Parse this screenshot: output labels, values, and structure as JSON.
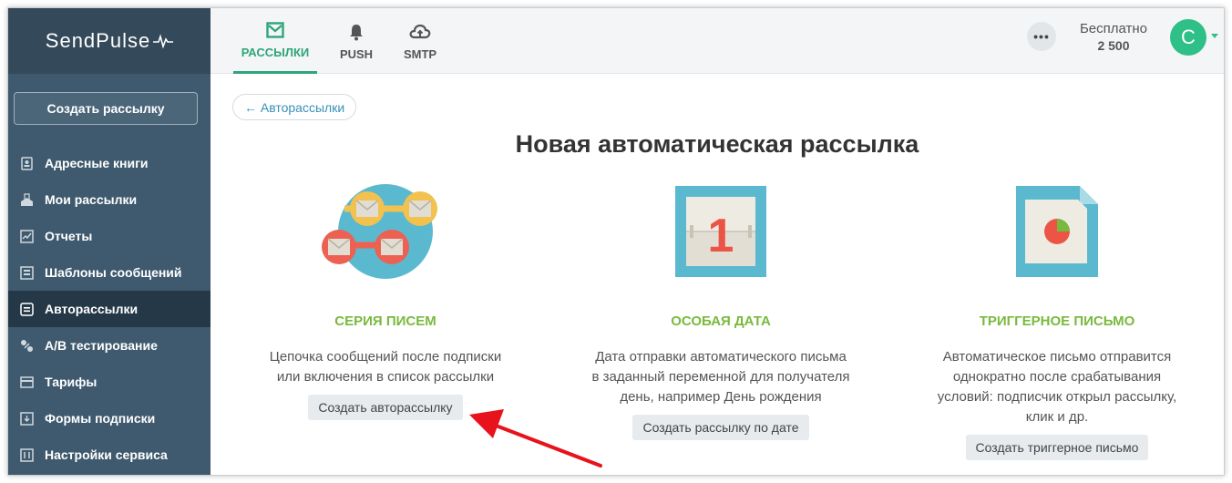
{
  "app": {
    "logo_text": "SendPulse"
  },
  "sidebar": {
    "create_label": "Создать рассылку",
    "items": [
      {
        "label": "Адресные книги",
        "icon": "address-book-icon"
      },
      {
        "label": "Мои рассылки",
        "icon": "campaigns-icon"
      },
      {
        "label": "Отчеты",
        "icon": "reports-icon"
      },
      {
        "label": "Шаблоны сообщений",
        "icon": "templates-icon"
      },
      {
        "label": "Авторассылки",
        "icon": "automation-icon",
        "active": true
      },
      {
        "label": "A/B тестирование",
        "icon": "ab-test-icon"
      },
      {
        "label": "Тарифы",
        "icon": "pricing-icon"
      },
      {
        "label": "Формы подписки",
        "icon": "forms-icon"
      },
      {
        "label": "Настройки сервиса",
        "icon": "settings-icon"
      }
    ]
  },
  "topbar": {
    "tabs": [
      {
        "label": "РАССЫЛКИ",
        "icon": "mail-icon",
        "active": true
      },
      {
        "label": "PUSH",
        "icon": "bell-icon"
      },
      {
        "label": "SMTP",
        "icon": "cloud-upload-icon"
      }
    ],
    "more_label": "•••",
    "plan_name": "Бесплатно",
    "plan_count": "2 500",
    "avatar_letter": "C"
  },
  "main": {
    "back_label": "← Авторассылки",
    "title": "Новая автоматическая рассылка",
    "cards": [
      {
        "title": "СЕРИЯ ПИСЕМ",
        "description": "Цепочка сообщений после подписки или включения в список рассылки",
        "button": "Создать авторассылку"
      },
      {
        "title": "ОСОБАЯ ДАТА",
        "calendar_number": "1",
        "description": "Дата отправки автоматического письма в заданный переменной для получателя день, например День рождения",
        "button": "Создать рассылку по дате"
      },
      {
        "title": "ТРИГГЕРНОЕ ПИСЬМО",
        "description": "Автоматическое письмо отправится однократно после срабатывания условий: подписчик открыл рассылку, клик и др.",
        "button": "Создать триггерное письмо"
      }
    ]
  },
  "colors": {
    "sidebar_bg": "#3f5a6e",
    "sidebar_active": "#253847",
    "accent_green": "#2ea57a",
    "card_title_green": "#79b93d",
    "arrow_red": "#e8121c"
  }
}
